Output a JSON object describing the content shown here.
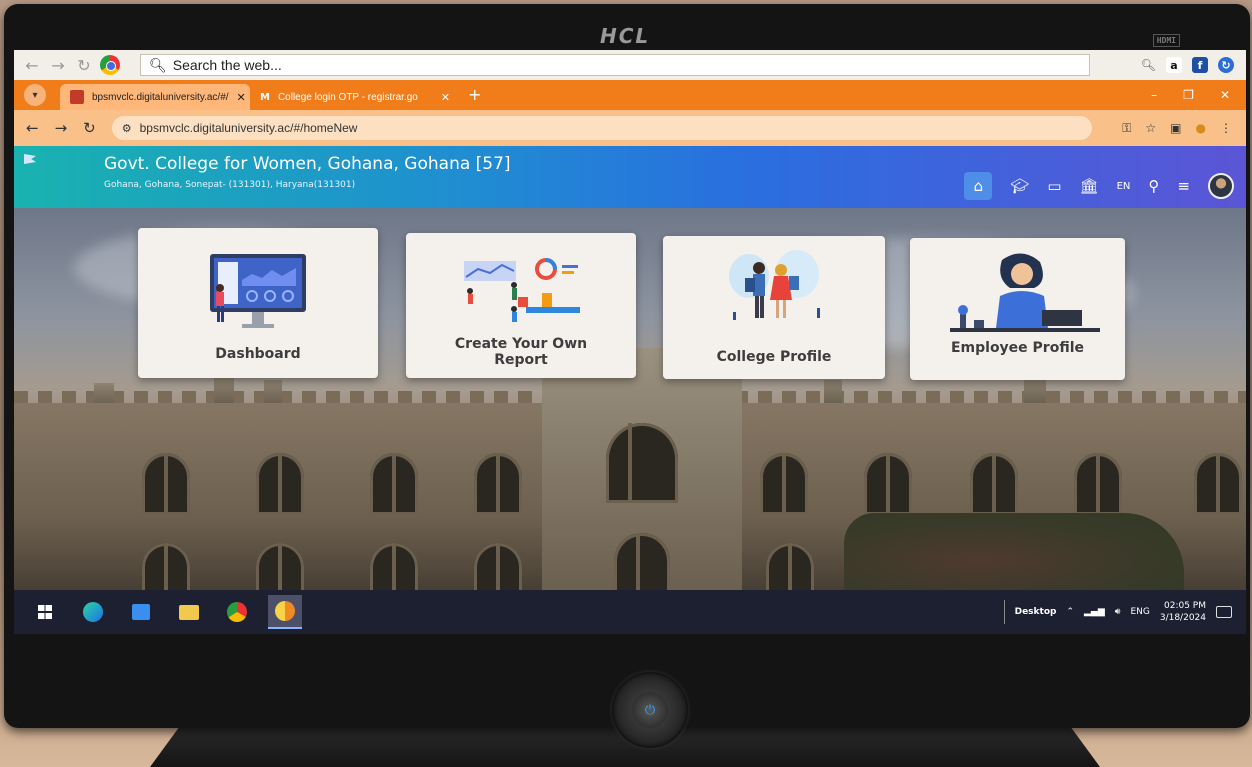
{
  "monitor": {
    "brand": "HCL",
    "port_label": "HDMI"
  },
  "browser": {
    "search_placeholder": "Search the web...",
    "tabs": [
      {
        "title": "bpsmvclc.digitaluniversity.ac/#/",
        "active": true
      },
      {
        "title": "College login OTP - registrar.go",
        "active": false
      }
    ],
    "address": "bpsmvclc.digitaluniversity.ac/#/homeNew",
    "language": "EN"
  },
  "site": {
    "college_name": "Govt. College for Women, Gohana, Gohana [57]",
    "college_address": "Gohana, Gohana, Sonepat- (131301), Haryana(131301)"
  },
  "cards": [
    {
      "label": "Dashboard"
    },
    {
      "label_line1": "Create Your Own",
      "label_line2": "Report"
    },
    {
      "label": "College Profile"
    },
    {
      "label": "Employee Profile"
    }
  ],
  "taskbar": {
    "desktop_label": "Desktop",
    "lang": "ENG",
    "time": "02:05 PM",
    "date": "3/18/2024"
  },
  "colors": {
    "tab_strip": "#f07c1a",
    "header_start": "#19b3b0",
    "header_end": "#5b55d6",
    "taskbar": "#1d2030"
  }
}
